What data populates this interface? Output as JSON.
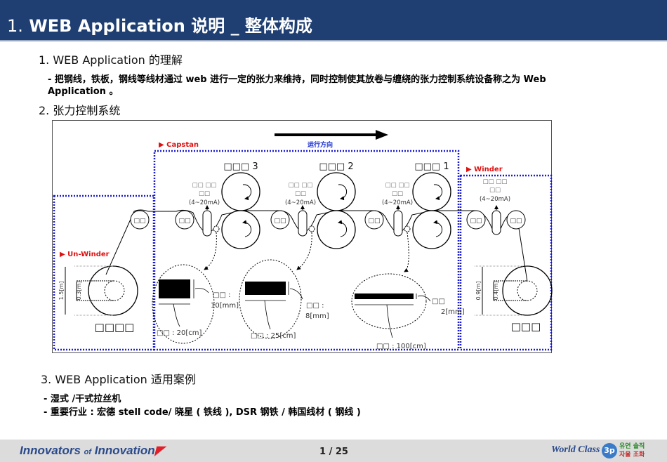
{
  "header": {
    "num": "1.",
    "title": "WEB Application  说明 _ 整体构成"
  },
  "section1": {
    "heading": "1. WEB Application  的理解",
    "bullet_line1": "-  把钢线，铁板，钢线等线材通过 web 进行一定的张力来维持，同时控制使其放卷与缠绕的张力控制系统设备称之为 Web",
    "bullet_line2": "Application 。"
  },
  "section2": {
    "heading": "2.  张力控制系统"
  },
  "diagram": {
    "direction": "运行方向",
    "capstan": "▶ Capstan",
    "unwinder": "▶ Un-Winder",
    "winder": "▶ Winder",
    "capstans": [
      "□□□ 3",
      "□□□ 2",
      "□□□ 1"
    ],
    "sensor_l1": "□□ □□",
    "sensor_l2": "□□",
    "sensor_l3": "(4~20mA)",
    "guide": "□□",
    "unwinder_name": "□□□□",
    "winder_name": "□□□",
    "unwinder_outer": "1.5[m]",
    "unwinder_inner": "0.3[m]",
    "winder_outer": "0.9[m]",
    "winder_inner": "0.4[m]",
    "w1_t_label": "□□ :",
    "w1_t": "10[mm]",
    "w1_w": "□□ : 20[cm]",
    "w2_t_label": "□□ :",
    "w2_t": "8[mm]",
    "w2_w": "□□ : 25[cm]",
    "w3_t_label": "□□",
    "w3_t": "2[mm]",
    "w3_w": "□□ : 100[cm]"
  },
  "section3": {
    "heading": "3. WEB Application  适用案例",
    "bullet1": "-  湿式 /干式拉丝机",
    "bullet2": "-  重要行业   :  宏德 stell code/ 晓星 ( 铁线 ), DSR 钢铁 / 韩国线材 ( 钢线 )"
  },
  "footer": {
    "brand1": "Innovators ",
    "brand_of": "of",
    "brand2": " Innovation",
    "page": "1 / 25",
    "wc": "World Class",
    "wc3p": "3p",
    "wc_ko1": "유연 솔직",
    "wc_ko2": "자율 조화"
  }
}
